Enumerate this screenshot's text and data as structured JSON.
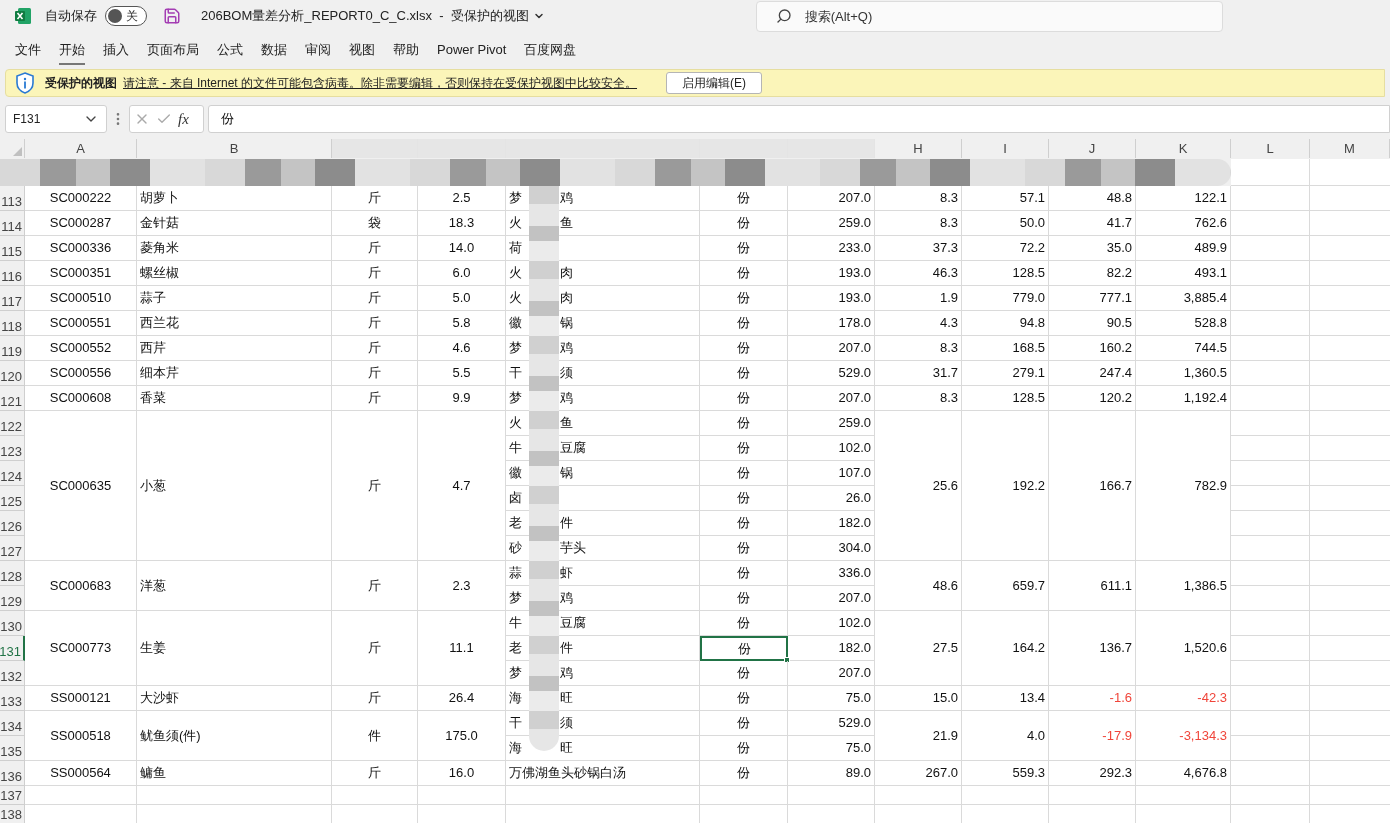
{
  "title_bar": {
    "autosave_label": "自动保存",
    "autosave_on": false,
    "autosave_state": "关",
    "file_name": "206BOM量差分析_REPORT0_C_C.xlsx",
    "separator": "-",
    "view_mode": "受保护的视图",
    "search_placeholder": "搜索(Alt+Q)"
  },
  "ribbon_tabs": [
    {
      "label": "文件",
      "selected": false
    },
    {
      "label": "开始",
      "selected": true
    },
    {
      "label": "插入",
      "selected": false
    },
    {
      "label": "页面布局",
      "selected": false
    },
    {
      "label": "公式",
      "selected": false
    },
    {
      "label": "数据",
      "selected": false
    },
    {
      "label": "审阅",
      "selected": false
    },
    {
      "label": "视图",
      "selected": false
    },
    {
      "label": "帮助",
      "selected": false
    },
    {
      "label": "Power Pivot",
      "selected": false
    },
    {
      "label": "百度网盘",
      "selected": false
    }
  ],
  "protected_bar": {
    "title": "受保护的视图",
    "message": "请注意 - 来自 Internet 的文件可能包含病毒。除非需要编辑，否则保持在受保护视图中比较安全。",
    "button": "启用编辑(E)"
  },
  "formula_bar": {
    "name_box": "F131",
    "fx_label": "fx",
    "formula": "份"
  },
  "column_headers": [
    {
      "label": "A",
      "hidden": false
    },
    {
      "label": "B",
      "hidden": false
    },
    {
      "hidden": true
    },
    {
      "hidden": true
    },
    {
      "hidden": true
    },
    {
      "hidden": true
    },
    {
      "hidden": true
    },
    {
      "label": "H",
      "hidden": false
    },
    {
      "label": "I",
      "hidden": false
    },
    {
      "label": "J",
      "hidden": false
    },
    {
      "label": "K",
      "hidden": false
    },
    {
      "label": "L",
      "hidden": false
    },
    {
      "label": "M",
      "hidden": false
    }
  ],
  "groups": [
    {
      "a": "SC000222",
      "b": "胡萝卜",
      "c": "斤",
      "d": "2.5",
      "h": "8.3",
      "i": "57.1",
      "j": "48.8",
      "k": "122.1",
      "negative": false,
      "rows": [
        {
          "row": "113",
          "e_head": "梦",
          "e_tail": "鸡",
          "f": "份",
          "g": "207.0",
          "selected": false
        }
      ]
    },
    {
      "a": "SC000287",
      "b": "金针菇",
      "c": "袋",
      "d": "18.3",
      "h": "8.3",
      "i": "50.0",
      "j": "41.7",
      "k": "762.6",
      "negative": false,
      "rows": [
        {
          "row": "114",
          "e_head": "火",
          "e_tail": "鱼",
          "f": "份",
          "g": "259.0",
          "selected": false
        }
      ]
    },
    {
      "a": "SC000336",
      "b": "菱角米",
      "c": "斤",
      "d": "14.0",
      "h": "37.3",
      "i": "72.2",
      "j": "35.0",
      "k": "489.9",
      "negative": false,
      "rows": [
        {
          "row": "115",
          "e_head": "荷",
          "f": "份",
          "g": "233.0",
          "selected": false
        }
      ]
    },
    {
      "a": "SC000351",
      "b": "螺丝椒",
      "c": "斤",
      "d": "6.0",
      "h": "46.3",
      "i": "128.5",
      "j": "82.2",
      "k": "493.1",
      "negative": false,
      "rows": [
        {
          "row": "116",
          "e_head": "火",
          "e_tail": "肉",
          "f": "份",
          "g": "193.0",
          "selected": false
        }
      ]
    },
    {
      "a": "SC000510",
      "b": "蒜子",
      "c": "斤",
      "d": "5.0",
      "h": "1.9",
      "i": "779.0",
      "j": "777.1",
      "k": "3,885.4",
      "negative": false,
      "rows": [
        {
          "row": "117",
          "e_head": "火",
          "e_tail": "肉",
          "f": "份",
          "g": "193.0",
          "selected": false
        }
      ]
    },
    {
      "a": "SC000551",
      "b": "西兰花",
      "c": "斤",
      "d": "5.8",
      "h": "4.3",
      "i": "94.8",
      "j": "90.5",
      "k": "528.8",
      "negative": false,
      "rows": [
        {
          "row": "118",
          "e_head": "徽",
          "e_tail": "锅",
          "f": "份",
          "g": "178.0",
          "selected": false
        }
      ]
    },
    {
      "a": "SC000552",
      "b": "西芹",
      "c": "斤",
      "d": "4.6",
      "h": "8.3",
      "i": "168.5",
      "j": "160.2",
      "k": "744.5",
      "negative": false,
      "rows": [
        {
          "row": "119",
          "e_head": "梦",
          "e_tail": "鸡",
          "f": "份",
          "g": "207.0",
          "selected": false
        }
      ]
    },
    {
      "a": "SC000556",
      "b": "细本芹",
      "c": "斤",
      "d": "5.5",
      "h": "31.7",
      "i": "279.1",
      "j": "247.4",
      "k": "1,360.5",
      "negative": false,
      "rows": [
        {
          "row": "120",
          "e_head": "干",
          "e_tail": "须",
          "f": "份",
          "g": "529.0",
          "selected": false
        }
      ]
    },
    {
      "a": "SC000608",
      "b": "香菜",
      "c": "斤",
      "d": "9.9",
      "h": "8.3",
      "i": "128.5",
      "j": "120.2",
      "k": "1,192.4",
      "negative": false,
      "rows": [
        {
          "row": "121",
          "e_head": "梦",
          "e_tail": "鸡",
          "f": "份",
          "g": "207.0",
          "selected": false
        }
      ]
    },
    {
      "a": "SC000635",
      "b": "小葱",
      "c": "斤",
      "d": "4.7",
      "h": "25.6",
      "i": "192.2",
      "j": "166.7",
      "k": "782.9",
      "negative": false,
      "rows": [
        {
          "row": "122",
          "e_head": "火",
          "e_tail": "鱼",
          "f": "份",
          "g": "259.0",
          "selected": false
        },
        {
          "row": "123",
          "e_head": "牛",
          "e_tail": "豆腐",
          "f": "份",
          "g": "102.0",
          "selected": false
        },
        {
          "row": "124",
          "e_head": "徽",
          "e_tail": "锅",
          "f": "份",
          "g": "107.0",
          "selected": false
        },
        {
          "row": "125",
          "e_head": "卤",
          "f": "份",
          "g": "26.0",
          "selected": false
        },
        {
          "row": "126",
          "e_head": "老",
          "e_tail": "件",
          "f": "份",
          "g": "182.0",
          "selected": false
        },
        {
          "row": "127",
          "e_head": "砂",
          "e_tail": "芋头",
          "f": "份",
          "g": "304.0",
          "selected": false
        }
      ]
    },
    {
      "a": "SC000683",
      "b": "洋葱",
      "c": "斤",
      "d": "2.3",
      "h": "48.6",
      "i": "659.7",
      "j": "611.1",
      "k": "1,386.5",
      "negative": false,
      "rows": [
        {
          "row": "128",
          "e_head": "蒜",
          "e_tail": "虾",
          "f": "份",
          "g": "336.0",
          "selected": false
        },
        {
          "row": "129",
          "e_head": "梦",
          "e_tail": "鸡",
          "f": "份",
          "g": "207.0",
          "selected": false
        }
      ]
    },
    {
      "a": "SC000773",
      "b": "生姜",
      "c": "斤",
      "d": "11.1",
      "h": "27.5",
      "i": "164.2",
      "j": "136.7",
      "k": "1,520.6",
      "negative": false,
      "rows": [
        {
          "row": "130",
          "e_head": "牛",
          "e_tail": "豆腐",
          "f": "份",
          "g": "102.0",
          "selected": false
        },
        {
          "row": "131",
          "e_head": "老",
          "e_tail": "件",
          "f": "份",
          "g": "182.0",
          "selected": true
        },
        {
          "row": "132",
          "e_head": "梦",
          "e_tail": "鸡",
          "f": "份",
          "g": "207.0",
          "selected": false
        }
      ]
    },
    {
      "a": "SS000121",
      "b": "大沙虾",
      "c": "斤",
      "d": "26.4",
      "h": "15.0",
      "i": "13.4",
      "j": "-1.6",
      "k": "-42.3",
      "negative": true,
      "rows": [
        {
          "row": "133",
          "e_head": "海",
          "e_tail": "旺",
          "f": "份",
          "g": "75.0",
          "selected": false
        }
      ]
    },
    {
      "a": "SS000518",
      "b": "鱿鱼须(件)",
      "c": "件",
      "d": "175.0",
      "h": "21.9",
      "i": "4.0",
      "j": "-17.9",
      "k": "-3,134.3",
      "negative": true,
      "rows": [
        {
          "row": "134",
          "e_head": "干",
          "e_tail": "须",
          "f": "份",
          "g": "529.0",
          "selected": false
        },
        {
          "row": "135",
          "e_head": "海",
          "e_tail": "旺",
          "f": "份",
          "g": "75.0",
          "selected": false
        }
      ]
    },
    {
      "a": "SS000564",
      "b": "鳙鱼",
      "c": "斤",
      "d": "16.0",
      "h": "267.0",
      "i": "559.3",
      "j": "292.3",
      "k": "4,676.8",
      "negative": false,
      "rows": [
        {
          "row": "136",
          "e_head": "万佛湖鱼头砂锅白汤",
          "f": "份",
          "g": "89.0",
          "selected": false
        }
      ]
    }
  ],
  "empty_rows": [
    "137",
    "138"
  ]
}
